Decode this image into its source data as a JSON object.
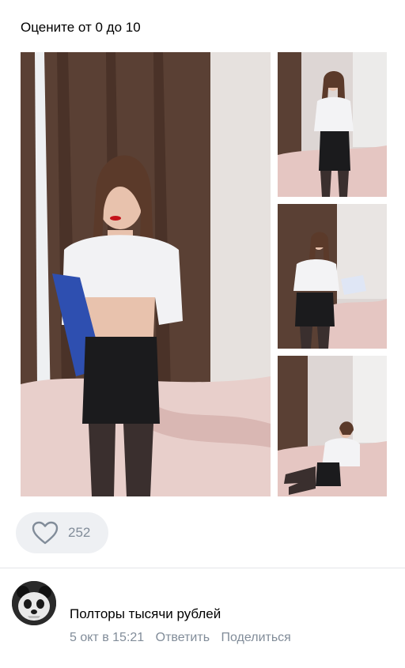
{
  "post": {
    "text": "Оцените от 0 до 10",
    "likes": {
      "count": "252",
      "icon": "heart-icon"
    }
  },
  "comment": {
    "text": "Полторы тысячи рублей",
    "date": "5 окт в 15:21",
    "reply_label": "Ответить",
    "share_label": "Поделиться"
  },
  "colors": {
    "meta_text": "#818c99",
    "like_background": "#eef0f3",
    "divider": "#e3e5e8"
  }
}
